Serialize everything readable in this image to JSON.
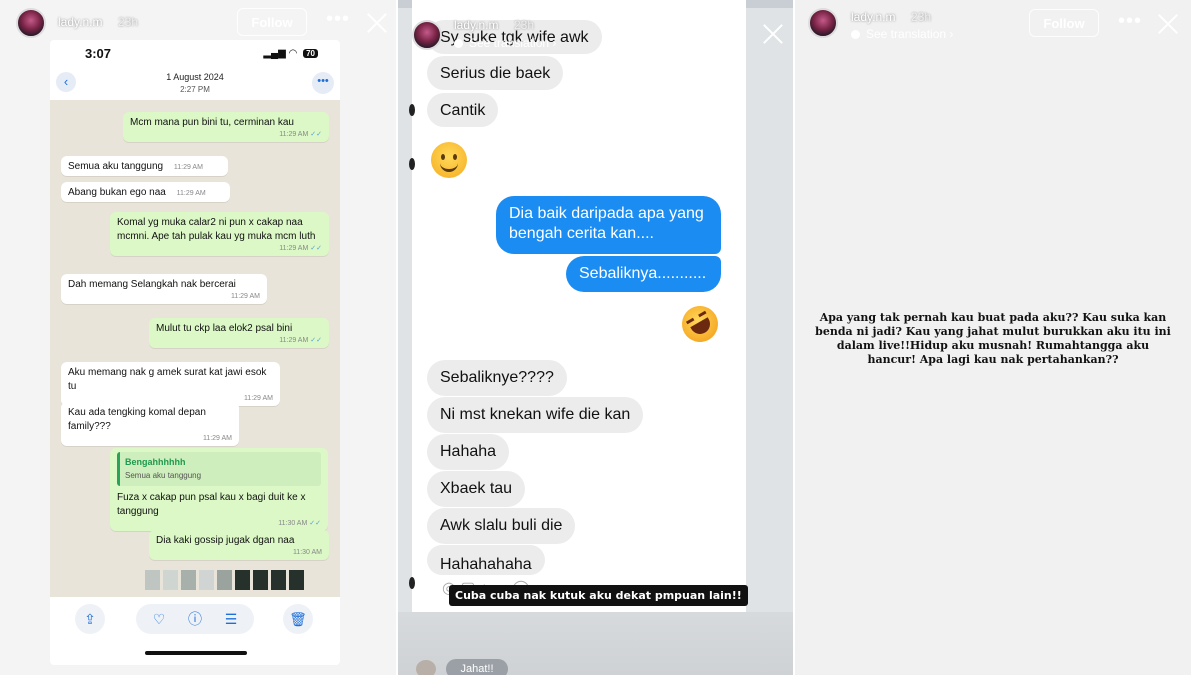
{
  "story": {
    "username": "lady.n.m",
    "time": "23h",
    "follow_label": "Follow",
    "more_icon": "more-horizontal-icon",
    "close_icon": "close-icon",
    "see_translation": "See translation ›"
  },
  "panel1": {
    "status": {
      "time": "3:07",
      "signal": "▂▄▆",
      "wifi": "wifi-icon",
      "battery": "70"
    },
    "chat_header": {
      "date": "1 August 2024",
      "time": "2:27 PM",
      "back_icon": "‹",
      "more_icon": "•••"
    },
    "messages": [
      {
        "dir": "out",
        "text": "Mcm mana pun bini tu, cerminan kau",
        "time": "11:29 AM"
      },
      {
        "dir": "in",
        "text": "Semua aku tanggung",
        "time": "11:29 AM"
      },
      {
        "dir": "in",
        "text": "Abang bukan ego naa",
        "time": "11:29 AM"
      },
      {
        "dir": "out",
        "text": "Komal yg muka calar2 ni pun x cakap naa mcmni. Ape tah pulak kau yg muka mcm luth",
        "time": "11:29 AM"
      },
      {
        "dir": "in",
        "text": "Dah memang Selangkah nak bercerai",
        "time": "11:29 AM"
      },
      {
        "dir": "out",
        "text": "Mulut tu ckp laa elok2 psal bini",
        "time": "11:29 AM"
      },
      {
        "dir": "in",
        "text": "Aku memang nak g amek surat kat jawi esok tu",
        "time": "11:29 AM"
      },
      {
        "dir": "in",
        "text": "Kau ada tengking komal depan family???",
        "time": "11:29 AM"
      },
      {
        "dir": "out",
        "quote_name": "Bengahhhhhh",
        "quote_text": "Semua aku tanggung",
        "text": "Fuza x cakap pun psal kau x bagi duit ke x tanggung",
        "time": "11:30 AM"
      },
      {
        "dir": "out",
        "text": "Dia kaki gossip jugak dgan naa",
        "time": "11:30 AM"
      }
    ],
    "toolbar": [
      "share-icon",
      "heart-icon",
      "info-icon",
      "adjust-icon",
      "trash-icon"
    ]
  },
  "panel2": {
    "messages": [
      {
        "dir": "in",
        "text": "Sy suke tgk wife awk"
      },
      {
        "dir": "in",
        "text": "Serius die baek"
      },
      {
        "dir": "in",
        "text": "Cantik"
      },
      {
        "dir": "in",
        "emoji": "smiling-face-emoji"
      },
      {
        "dir": "out",
        "text": "Dia baik daripada apa yang bengah cerita kan...."
      },
      {
        "dir": "out",
        "text": "Sebaliknya..........."
      },
      {
        "dir": "out",
        "emoji": "rolling-on-floor-laughing-emoji"
      },
      {
        "dir": "in",
        "text": "Sebaliknye????"
      },
      {
        "dir": "in",
        "text": "Ni mst knekan wife die kan"
      },
      {
        "dir": "in",
        "text": "Hahaha"
      },
      {
        "dir": "in",
        "text": "Xbaek tau"
      },
      {
        "dir": "in",
        "text": "Awk slalu buli die"
      },
      {
        "dir": "in",
        "text": "Hahahahaha"
      }
    ],
    "caption": "Cuba cuba nak kutuk aku dekat pmpuan lain!!",
    "reply_chip": "Jahat!!"
  },
  "panel3": {
    "text": "Apa yang tak pernah kau buat pada aku?? Kau suka kan benda ni jadi? Kau yang jahat mulut burukkan aku itu ini dalam live!!Hidup aku musnah! Rumahtangga aku hancur! Apa lagi kau nak pertahankan??"
  },
  "colors": {
    "wa_out": "#dbf8c6",
    "wa_in": "#ffffff",
    "wa_bg": "#e9e4d9",
    "ig_blue": "#1b8cf2",
    "ig_gray": "#ececec"
  }
}
